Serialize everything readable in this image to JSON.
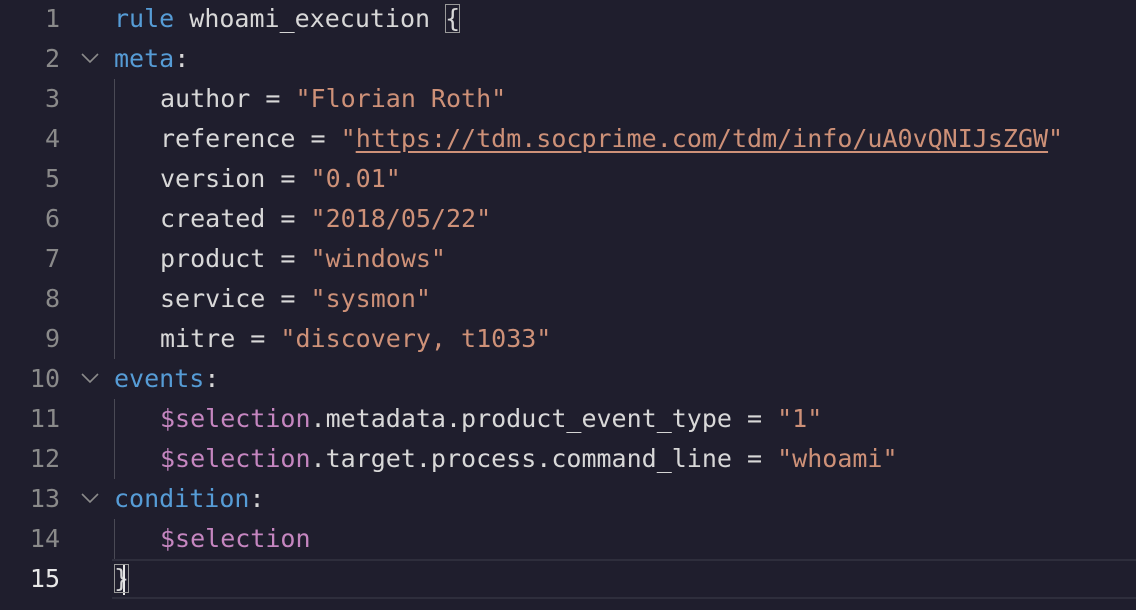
{
  "lines": [
    {
      "num": "1",
      "parts": [
        {
          "t": "rule",
          "c": "kw"
        },
        {
          "t": " whoami_execution ",
          "c": "plain"
        },
        {
          "t": "{",
          "c": "plain brace-box"
        }
      ]
    },
    {
      "num": "2",
      "fold": true,
      "parts": [
        {
          "t": "meta",
          "c": "kw"
        },
        {
          "t": ":",
          "c": "plain"
        }
      ]
    },
    {
      "num": "3",
      "indent": true,
      "parts": [
        {
          "t": "author = ",
          "c": "plain"
        },
        {
          "t": "\"Florian Roth\"",
          "c": "str"
        }
      ]
    },
    {
      "num": "4",
      "indent": true,
      "parts": [
        {
          "t": "reference = ",
          "c": "plain"
        },
        {
          "t": "\"",
          "c": "str"
        },
        {
          "t": "https://tdm.socprime.com/tdm/info/uA0vQNIJsZGW",
          "c": "link"
        },
        {
          "t": "\"",
          "c": "str"
        }
      ]
    },
    {
      "num": "5",
      "indent": true,
      "parts": [
        {
          "t": "version = ",
          "c": "plain"
        },
        {
          "t": "\"0.01\"",
          "c": "str"
        }
      ]
    },
    {
      "num": "6",
      "indent": true,
      "parts": [
        {
          "t": "created = ",
          "c": "plain"
        },
        {
          "t": "\"2018/05/22\"",
          "c": "str"
        }
      ]
    },
    {
      "num": "7",
      "indent": true,
      "parts": [
        {
          "t": "product = ",
          "c": "plain"
        },
        {
          "t": "\"windows\"",
          "c": "str"
        }
      ]
    },
    {
      "num": "8",
      "indent": true,
      "parts": [
        {
          "t": "service = ",
          "c": "plain"
        },
        {
          "t": "\"sysmon\"",
          "c": "str"
        }
      ]
    },
    {
      "num": "9",
      "indent": true,
      "parts": [
        {
          "t": "mitre = ",
          "c": "plain"
        },
        {
          "t": "\"discovery, t1033\"",
          "c": "str"
        }
      ]
    },
    {
      "num": "10",
      "fold": true,
      "parts": [
        {
          "t": "events",
          "c": "kw"
        },
        {
          "t": ":",
          "c": "plain"
        }
      ]
    },
    {
      "num": "11",
      "indent": true,
      "parts": [
        {
          "t": "$selection",
          "c": "var"
        },
        {
          "t": ".metadata.product_event_type = ",
          "c": "plain"
        },
        {
          "t": "\"1\"",
          "c": "str"
        }
      ]
    },
    {
      "num": "12",
      "indent": true,
      "parts": [
        {
          "t": "$selection",
          "c": "var"
        },
        {
          "t": ".target.process.command_line = ",
          "c": "plain"
        },
        {
          "t": "\"whoami\"",
          "c": "str"
        }
      ]
    },
    {
      "num": "13",
      "fold": true,
      "parts": [
        {
          "t": "condition",
          "c": "kw"
        },
        {
          "t": ":",
          "c": "plain"
        }
      ]
    },
    {
      "num": "14",
      "indent": true,
      "parts": [
        {
          "t": "$selection",
          "c": "var"
        }
      ]
    },
    {
      "num": "15",
      "current": true,
      "parts": [
        {
          "t": "}",
          "c": "plain brace-box"
        }
      ]
    }
  ],
  "colors": {
    "background": "#1f1e2d",
    "keyword": "#569cd6",
    "string": "#ce9178",
    "variable": "#c586c0",
    "text": "#d8d8d8",
    "line_number": "#8a8a8a"
  },
  "icons": {
    "fold": "chevron-down-icon"
  }
}
